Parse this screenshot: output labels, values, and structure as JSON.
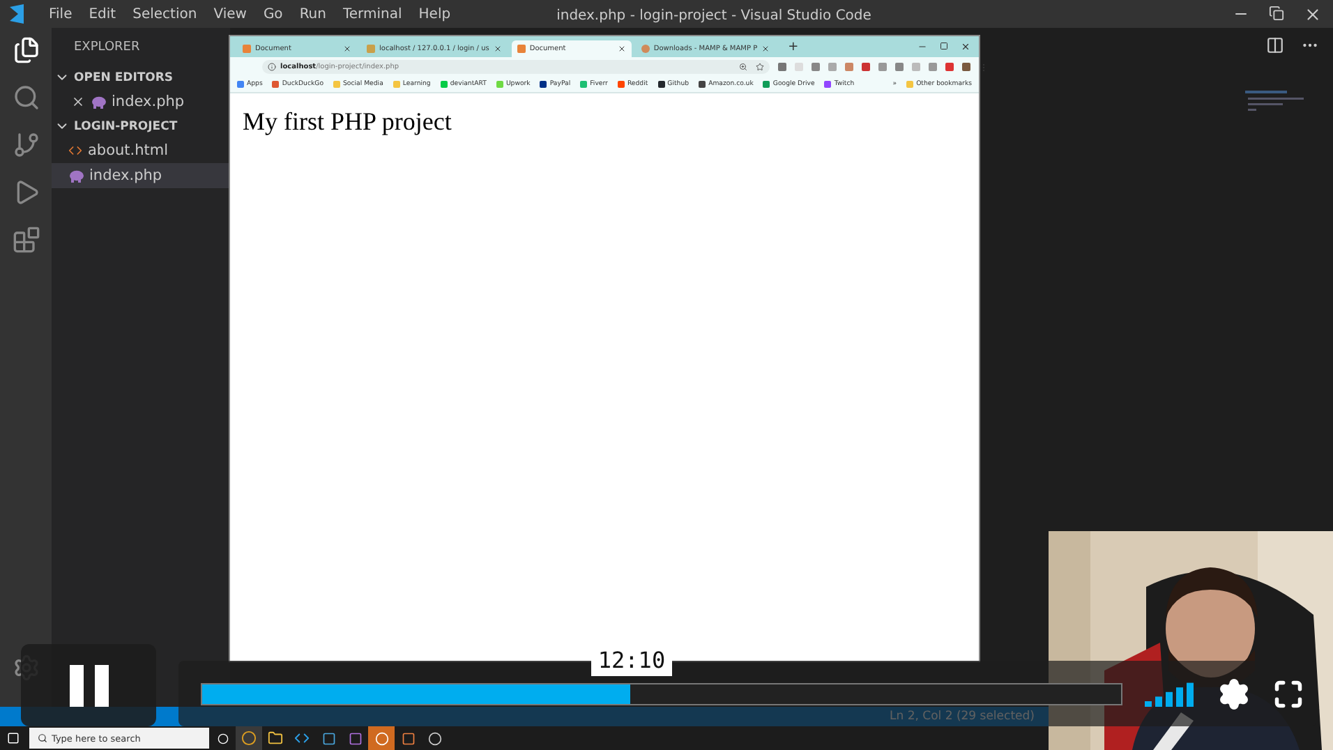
{
  "vscode": {
    "title": "index.php - login-project - Visual Studio Code",
    "menu": [
      "File",
      "Edit",
      "Selection",
      "View",
      "Go",
      "Run",
      "Terminal",
      "Help"
    ],
    "sidebar": {
      "title": "EXPLORER",
      "sections": [
        {
          "label": "OPEN EDITORS",
          "expanded": true,
          "files": [
            {
              "name": "index.php",
              "kind": "php",
              "selected": false,
              "closable": true
            }
          ]
        },
        {
          "label": "LOGIN-PROJECT",
          "expanded": true,
          "files": [
            {
              "name": "about.html",
              "kind": "html",
              "selected": false,
              "closable": false
            },
            {
              "name": "index.php",
              "kind": "php",
              "selected": true,
              "closable": false
            }
          ]
        }
      ]
    },
    "status_bar": {
      "position": "Ln 2, Col 2 (29 selected)"
    }
  },
  "browser": {
    "tabs": [
      {
        "title": "Document",
        "kind": "html",
        "selected": false
      },
      {
        "title": "localhost / 127.0.0.1 / login / us",
        "kind": "db",
        "selected": false
      },
      {
        "title": "Document",
        "kind": "html",
        "selected": true
      },
      {
        "title": "Downloads - MAMP & MAMP P",
        "kind": "mamp",
        "selected": false
      }
    ],
    "new_tab": "+",
    "address": {
      "host": "localhost",
      "path": "/login-project/index.php"
    },
    "bookmarks": [
      {
        "label": "Apps",
        "color": "#4285f4"
      },
      {
        "label": "DuckDuckGo",
        "color": "#de5833"
      },
      {
        "label": "Social Media",
        "color": "#f4c542"
      },
      {
        "label": "Learning",
        "color": "#f4c542"
      },
      {
        "label": "deviantART",
        "color": "#05cc47"
      },
      {
        "label": "Upwork",
        "color": "#6fda44"
      },
      {
        "label": "PayPal",
        "color": "#003087"
      },
      {
        "label": "Fiverr",
        "color": "#1dbf73"
      },
      {
        "label": "Reddit",
        "color": "#ff4500"
      },
      {
        "label": "Github",
        "color": "#24292e"
      },
      {
        "label": "Amazon.co.uk",
        "color": "#444444"
      },
      {
        "label": "Google Drive",
        "color": "#0f9d58"
      },
      {
        "label": "Twitch",
        "color": "#9146ff"
      }
    ],
    "overflow": "»",
    "other_bookmarks": "Other bookmarks",
    "page": {
      "heading": "My first PHP project"
    }
  },
  "taskbar": {
    "search": {
      "placeholder": "Type here to search"
    }
  },
  "player": {
    "playing": true,
    "level": 0.466,
    "time": "12:10"
  }
}
